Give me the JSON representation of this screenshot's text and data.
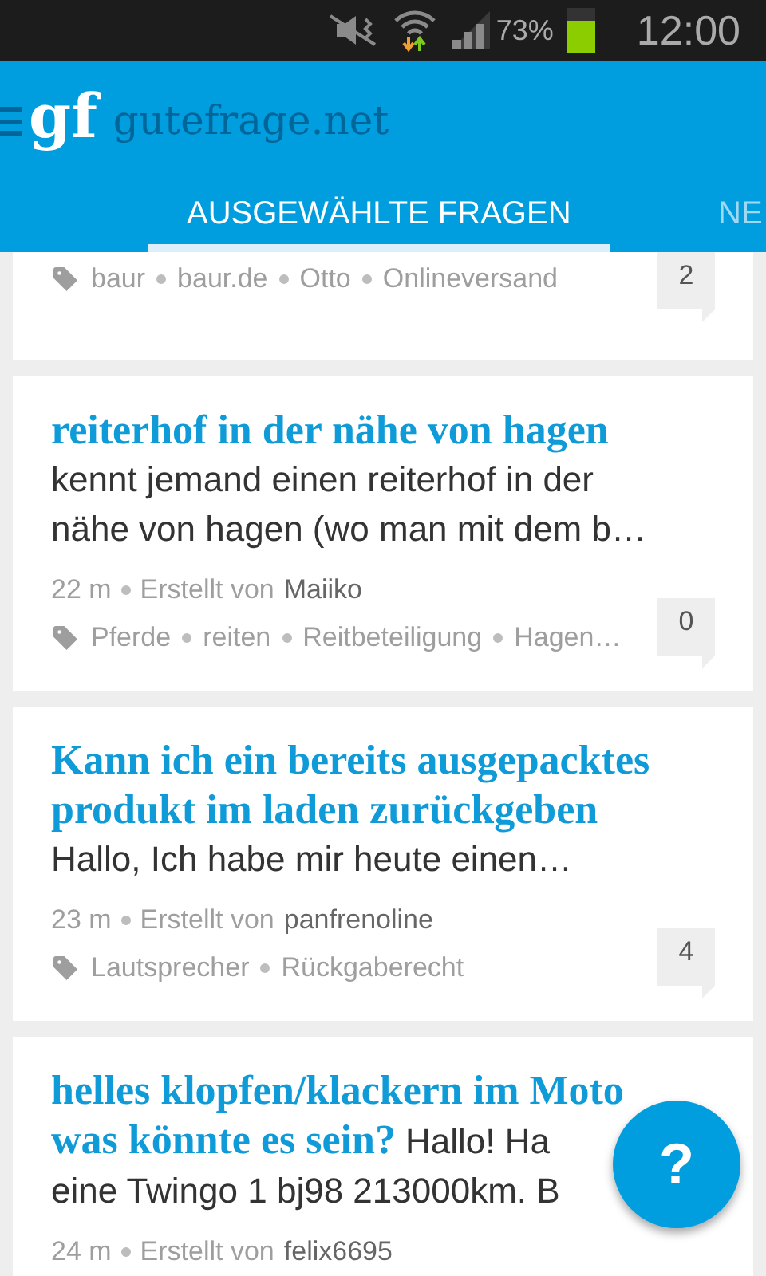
{
  "status_bar": {
    "battery_percent": "73%",
    "time": "12:00"
  },
  "app_bar": {
    "logo": "gf",
    "title": "gutefrage.net"
  },
  "tabs": [
    {
      "label": "AUSGEWÄHLTE FRAGEN",
      "selected": true
    },
    {
      "label": "NE",
      "selected": false
    }
  ],
  "questions": [
    {
      "tags": [
        "baur",
        "baur.de",
        "Otto",
        "Onlineversand"
      ],
      "answers": "2"
    },
    {
      "title": "reiterhof in der nähe von hagen",
      "body_lines": [
        "kennt jemand einen reiterhof in der",
        "nähe von hagen (wo man mit dem b…"
      ],
      "age": "22 m",
      "created_by": "Erstellt von",
      "author": "Maiiko",
      "tags": [
        "Pferde",
        "reiten",
        "Reitbeteiligung",
        "Hagen…"
      ],
      "answers": "0"
    },
    {
      "title": "Kann ich ein bereits ausgepacktes produkt im laden zurückgeben",
      "body_lines": [
        "Hallo, Ich habe mir heute einen…"
      ],
      "age": "23 m",
      "created_by": "Erstellt von",
      "author": "panfrenoline",
      "tags": [
        "Lautsprecher",
        "Rückgaberecht"
      ],
      "answers": "4"
    },
    {
      "title_lines": [
        "helles klopfen/klackern im Moto",
        "was könnte es sein?"
      ],
      "body_lines": [
        "Hallo! Ha",
        "eine Twingo 1 bj98 213000km. B"
      ],
      "age": "24 m",
      "created_by": "Erstellt von",
      "author": "felix6695"
    }
  ],
  "fab": {
    "label": "?"
  }
}
